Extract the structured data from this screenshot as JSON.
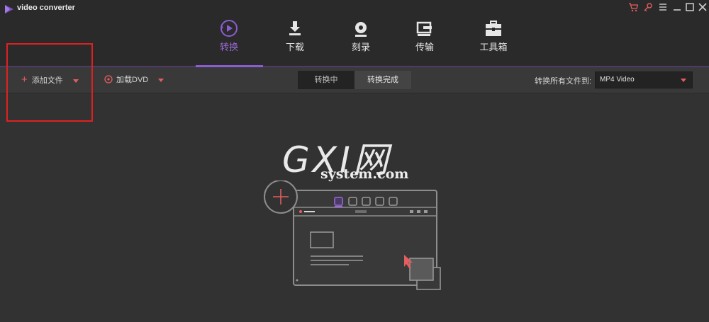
{
  "app": {
    "title": "video converter"
  },
  "window_controls": [
    {
      "name": "cart-icon",
      "glyph": "🛒",
      "color": "#e55d5d"
    },
    {
      "name": "key-icon",
      "glyph": "⚷",
      "color": "#e55d5d"
    },
    {
      "name": "menu-icon",
      "glyph": "☰",
      "color": "#d0d0d0"
    },
    {
      "name": "minimize-icon",
      "glyph": "—",
      "color": "#d0d0d0"
    },
    {
      "name": "maximize-icon",
      "glyph": "☐",
      "color": "#d0d0d0"
    },
    {
      "name": "close-icon",
      "glyph": "✕",
      "color": "#d0d0d0"
    }
  ],
  "nav": {
    "tabs": [
      {
        "label": "转换",
        "icon": "convert-icon",
        "active": true
      },
      {
        "label": "下载",
        "icon": "download-icon",
        "active": false
      },
      {
        "label": "刻录",
        "icon": "burn-icon",
        "active": false
      },
      {
        "label": "传输",
        "icon": "transfer-icon",
        "active": false
      },
      {
        "label": "工具箱",
        "icon": "toolbox-icon",
        "active": false
      }
    ]
  },
  "toolbar": {
    "add_files": "添加文件",
    "load_dvd": "加载DVD",
    "seg_converting": "转换中",
    "seg_done": "转换完成",
    "convert_all_label": "转换所有文件到:",
    "format_value": "MP4 Video"
  },
  "watermark": {
    "big": "GXI网",
    "small": "system.com"
  },
  "colors": {
    "accent": "#8a5ed0",
    "red": "#e55d5d",
    "bg": "#333233",
    "header": "#2b2a2b"
  }
}
